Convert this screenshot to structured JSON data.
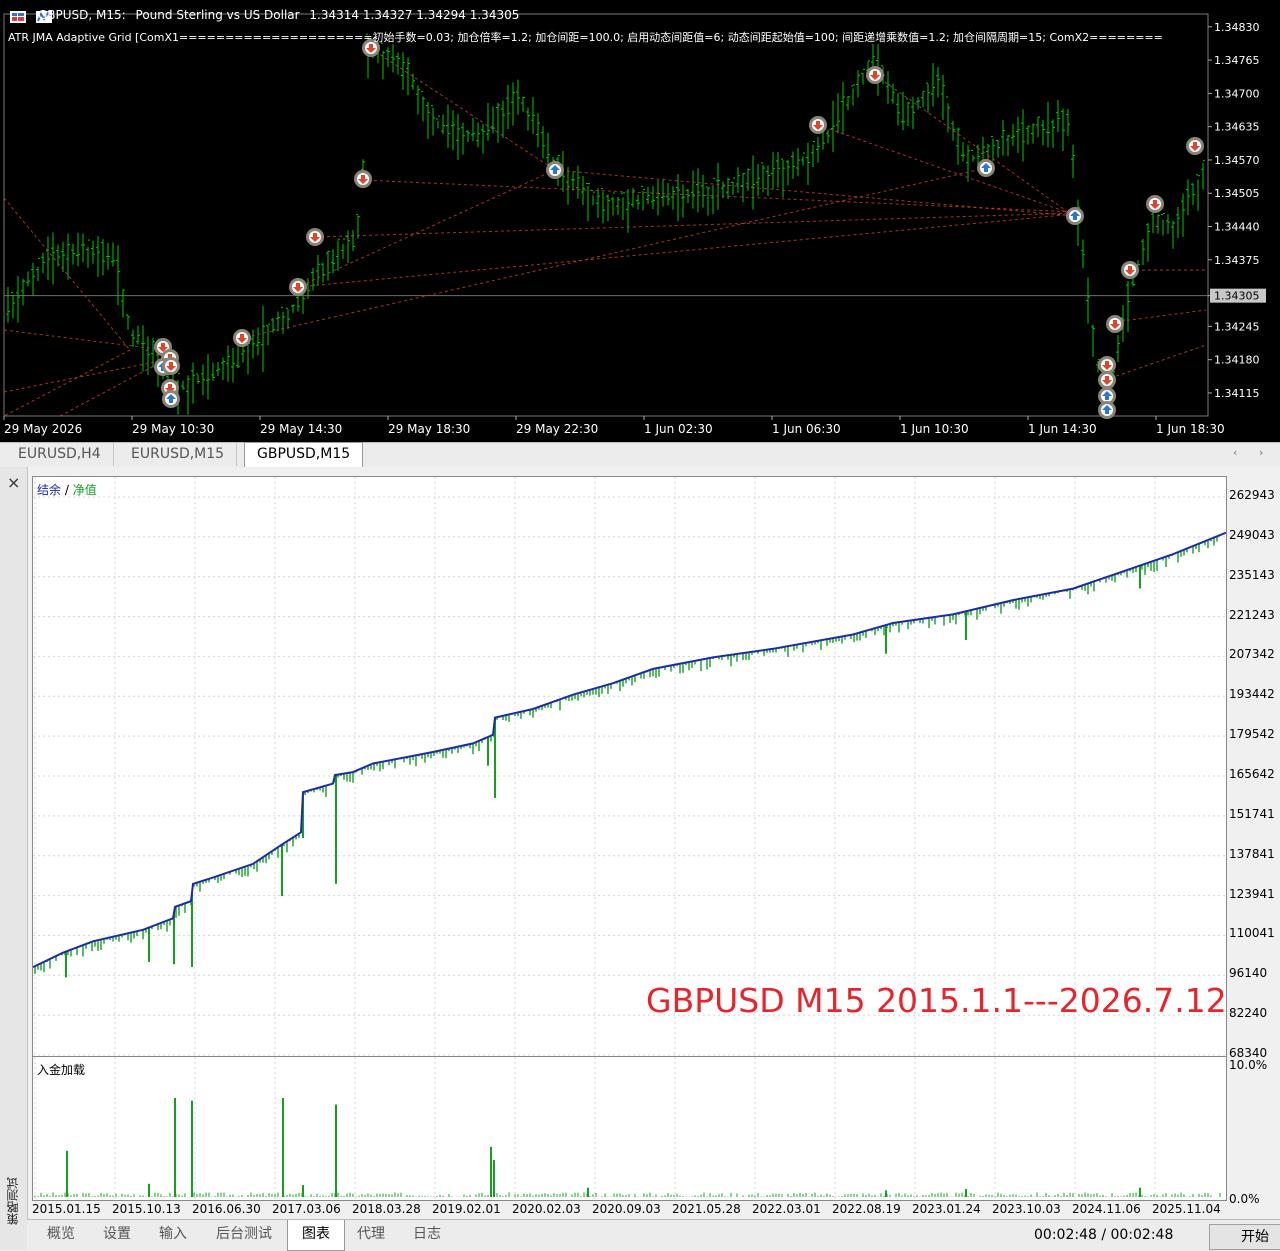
{
  "top_chart": {
    "symbol_title": "GBPUSD, M15:",
    "description": "Pound Sterling vs US Dollar",
    "ohlc": "1.34314 1.34327 1.34294 1.34305",
    "indicator_line": "ATR JMA Adaptive Grid [ComX1=====================初始手数=0.03; 加仓倍率=1.2; 加仓间距=100.0; 启用动态间距值=6; 动态间距起始值=100; 间距递增乘数值=1.2; 加仓间隔周期=15; ComX2========",
    "current_price": "1.34305",
    "y_axis": [
      "1.34830",
      "1.34765",
      "1.34700",
      "1.34635",
      "1.34570",
      "1.34505",
      "1.34440",
      "1.34375",
      "1.34305",
      "1.34245",
      "1.34180",
      "1.34115"
    ],
    "x_axis": [
      "29 May 2026",
      "29 May 10:30",
      "29 May 14:30",
      "29 May 18:30",
      "29 May 22:30",
      "1 Jun 02:30",
      "1 Jun 06:30",
      "1 Jun 10:30",
      "1 Jun 14:30",
      "1 Jun 18:30"
    ],
    "colors": {
      "bar": "#00c800",
      "grid_link": "#c83c2a",
      "sell_marker": "#e0452a",
      "buy_marker": "#2877d8"
    }
  },
  "chart_tabs": {
    "items": [
      {
        "label": "EURUSD,H4"
      },
      {
        "label": "EURUSD,M15"
      },
      {
        "label": "GBPUSD,M15"
      }
    ],
    "active_index": 2,
    "prev_arrow": "‹",
    "next_arrow": "›"
  },
  "tester": {
    "close_icon": "×",
    "sidebar_label": "策略测试",
    "legend_balance": "结余",
    "legend_sep": " / ",
    "legend_equity": "净值",
    "load_label": "入金加载",
    "overlay_text": "GBPUSD M15 2015.1.1---2026.7.12",
    "y_axis": [
      "262943",
      "249043",
      "235143",
      "221243",
      "207342",
      "193442",
      "179542",
      "165642",
      "151741",
      "137841",
      "123941",
      "110041",
      "96140",
      "82240",
      "68340"
    ],
    "load_axis": [
      "10.0%",
      "0.0%"
    ],
    "x_axis": [
      "2015.01.15",
      "2015.10.13",
      "2016.06.30",
      "2017.03.06",
      "2018.03.28",
      "2019.02.01",
      "2020.02.03",
      "2020.09.03",
      "2021.05.28",
      "2022.03.01",
      "2022.08.19",
      "2023.01.24",
      "2023.10.03",
      "2024.11.06",
      "2025.11.04"
    ],
    "colors": {
      "balance": "#1f2aa8",
      "equity": "#14a01e",
      "load": "#14a01e"
    },
    "bottom_tabs": [
      {
        "label": "概览"
      },
      {
        "label": "设置"
      },
      {
        "label": "输入"
      },
      {
        "label": "后台测试"
      },
      {
        "label": "图表"
      },
      {
        "label": "代理"
      },
      {
        "label": "日志"
      }
    ],
    "active_bottom_tab": 4,
    "timer": "00:02:48 / 00:02:48",
    "start_button": "开始"
  },
  "chart_data": [
    {
      "type": "line",
      "title": "",
      "series": [
        {
          "name": "结余",
          "x": [
            "2015.01.15",
            "2015.10.13",
            "2016.06.30",
            "2017.03.06",
            "2018.03.28",
            "2019.02.01",
            "2020.02.03",
            "2020.09.03",
            "2021.05.28",
            "2022.03.01",
            "2022.08.19",
            "2023.01.24",
            "2023.10.03",
            "2024.11.06",
            "2025.11.04",
            "2026.07.12"
          ],
          "values": [
            99000,
            111000,
            129000,
            163000,
            170000,
            178000,
            193000,
            201000,
            208000,
            214000,
            220000,
            228000,
            236000,
            244000,
            249000,
            251000
          ]
        },
        {
          "name": "净值",
          "x": [
            "2015.01.15",
            "2015.10.13",
            "2016.06.30",
            "2017.03.06",
            "2018.03.28",
            "2019.02.01",
            "2020.02.03",
            "2020.09.03",
            "2021.05.28",
            "2022.03.01",
            "2022.08.19",
            "2023.01.24",
            "2023.10.03",
            "2024.11.06",
            "2025.11.04",
            "2026.07.12"
          ],
          "values": [
            98000,
            110000,
            128000,
            162000,
            169000,
            177000,
            192000,
            200000,
            207000,
            213000,
            219000,
            227000,
            235000,
            243000,
            248000,
            250000
          ]
        }
      ],
      "ylim": [
        68340,
        262943
      ]
    },
    {
      "type": "bar",
      "title": "入金加载",
      "ylim": [
        0,
        10
      ],
      "peak_values": [
        {
          "x": "2015.04",
          "value": 3.5
        },
        {
          "x": "2016.02",
          "value": 7.5
        },
        {
          "x": "2016.06",
          "value": 7.3
        },
        {
          "x": "2017.03",
          "value": 7.5
        },
        {
          "x": "2017.09",
          "value": 7.0
        },
        {
          "x": "2019.06",
          "value": 3.8
        },
        {
          "x": "2019.06b",
          "value": 2.8
        }
      ]
    }
  ]
}
